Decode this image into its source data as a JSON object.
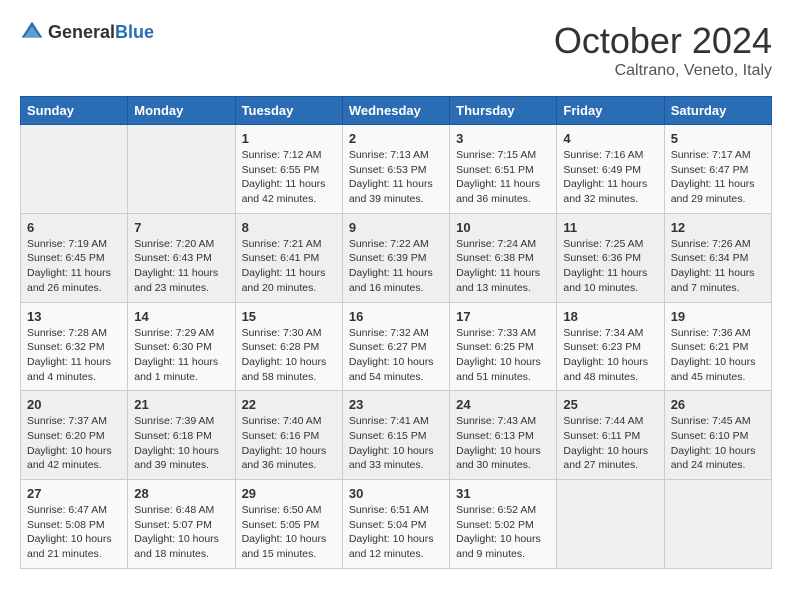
{
  "header": {
    "logo": {
      "general": "General",
      "blue": "Blue"
    },
    "title": "October 2024",
    "location": "Caltrano, Veneto, Italy"
  },
  "days_of_week": [
    "Sunday",
    "Monday",
    "Tuesday",
    "Wednesday",
    "Thursday",
    "Friday",
    "Saturday"
  ],
  "weeks": [
    [
      {
        "day": "",
        "content": ""
      },
      {
        "day": "",
        "content": ""
      },
      {
        "day": "1",
        "content": "Sunrise: 7:12 AM\nSunset: 6:55 PM\nDaylight: 11 hours and 42 minutes."
      },
      {
        "day": "2",
        "content": "Sunrise: 7:13 AM\nSunset: 6:53 PM\nDaylight: 11 hours and 39 minutes."
      },
      {
        "day": "3",
        "content": "Sunrise: 7:15 AM\nSunset: 6:51 PM\nDaylight: 11 hours and 36 minutes."
      },
      {
        "day": "4",
        "content": "Sunrise: 7:16 AM\nSunset: 6:49 PM\nDaylight: 11 hours and 32 minutes."
      },
      {
        "day": "5",
        "content": "Sunrise: 7:17 AM\nSunset: 6:47 PM\nDaylight: 11 hours and 29 minutes."
      }
    ],
    [
      {
        "day": "6",
        "content": "Sunrise: 7:19 AM\nSunset: 6:45 PM\nDaylight: 11 hours and 26 minutes."
      },
      {
        "day": "7",
        "content": "Sunrise: 7:20 AM\nSunset: 6:43 PM\nDaylight: 11 hours and 23 minutes."
      },
      {
        "day": "8",
        "content": "Sunrise: 7:21 AM\nSunset: 6:41 PM\nDaylight: 11 hours and 20 minutes."
      },
      {
        "day": "9",
        "content": "Sunrise: 7:22 AM\nSunset: 6:39 PM\nDaylight: 11 hours and 16 minutes."
      },
      {
        "day": "10",
        "content": "Sunrise: 7:24 AM\nSunset: 6:38 PM\nDaylight: 11 hours and 13 minutes."
      },
      {
        "day": "11",
        "content": "Sunrise: 7:25 AM\nSunset: 6:36 PM\nDaylight: 11 hours and 10 minutes."
      },
      {
        "day": "12",
        "content": "Sunrise: 7:26 AM\nSunset: 6:34 PM\nDaylight: 11 hours and 7 minutes."
      }
    ],
    [
      {
        "day": "13",
        "content": "Sunrise: 7:28 AM\nSunset: 6:32 PM\nDaylight: 11 hours and 4 minutes."
      },
      {
        "day": "14",
        "content": "Sunrise: 7:29 AM\nSunset: 6:30 PM\nDaylight: 11 hours and 1 minute."
      },
      {
        "day": "15",
        "content": "Sunrise: 7:30 AM\nSunset: 6:28 PM\nDaylight: 10 hours and 58 minutes."
      },
      {
        "day": "16",
        "content": "Sunrise: 7:32 AM\nSunset: 6:27 PM\nDaylight: 10 hours and 54 minutes."
      },
      {
        "day": "17",
        "content": "Sunrise: 7:33 AM\nSunset: 6:25 PM\nDaylight: 10 hours and 51 minutes."
      },
      {
        "day": "18",
        "content": "Sunrise: 7:34 AM\nSunset: 6:23 PM\nDaylight: 10 hours and 48 minutes."
      },
      {
        "day": "19",
        "content": "Sunrise: 7:36 AM\nSunset: 6:21 PM\nDaylight: 10 hours and 45 minutes."
      }
    ],
    [
      {
        "day": "20",
        "content": "Sunrise: 7:37 AM\nSunset: 6:20 PM\nDaylight: 10 hours and 42 minutes."
      },
      {
        "day": "21",
        "content": "Sunrise: 7:39 AM\nSunset: 6:18 PM\nDaylight: 10 hours and 39 minutes."
      },
      {
        "day": "22",
        "content": "Sunrise: 7:40 AM\nSunset: 6:16 PM\nDaylight: 10 hours and 36 minutes."
      },
      {
        "day": "23",
        "content": "Sunrise: 7:41 AM\nSunset: 6:15 PM\nDaylight: 10 hours and 33 minutes."
      },
      {
        "day": "24",
        "content": "Sunrise: 7:43 AM\nSunset: 6:13 PM\nDaylight: 10 hours and 30 minutes."
      },
      {
        "day": "25",
        "content": "Sunrise: 7:44 AM\nSunset: 6:11 PM\nDaylight: 10 hours and 27 minutes."
      },
      {
        "day": "26",
        "content": "Sunrise: 7:45 AM\nSunset: 6:10 PM\nDaylight: 10 hours and 24 minutes."
      }
    ],
    [
      {
        "day": "27",
        "content": "Sunrise: 6:47 AM\nSunset: 5:08 PM\nDaylight: 10 hours and 21 minutes."
      },
      {
        "day": "28",
        "content": "Sunrise: 6:48 AM\nSunset: 5:07 PM\nDaylight: 10 hours and 18 minutes."
      },
      {
        "day": "29",
        "content": "Sunrise: 6:50 AM\nSunset: 5:05 PM\nDaylight: 10 hours and 15 minutes."
      },
      {
        "day": "30",
        "content": "Sunrise: 6:51 AM\nSunset: 5:04 PM\nDaylight: 10 hours and 12 minutes."
      },
      {
        "day": "31",
        "content": "Sunrise: 6:52 AM\nSunset: 5:02 PM\nDaylight: 10 hours and 9 minutes."
      },
      {
        "day": "",
        "content": ""
      },
      {
        "day": "",
        "content": ""
      }
    ]
  ]
}
